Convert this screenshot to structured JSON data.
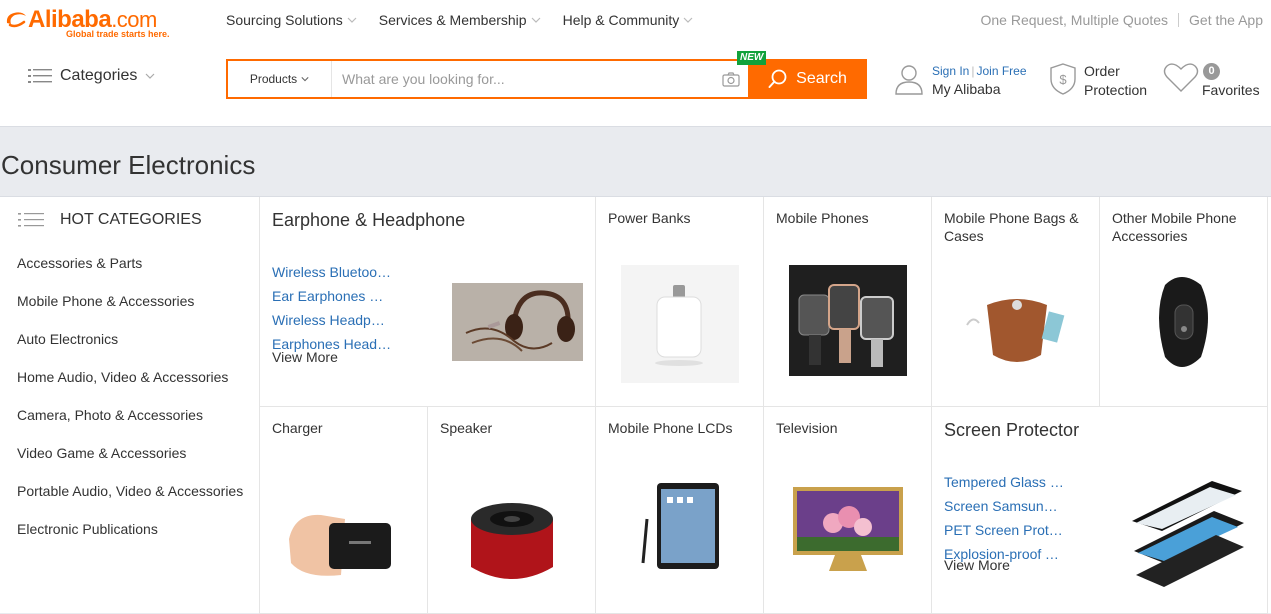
{
  "brand": {
    "logo_name": "Alibaba",
    "logo_suffix": ".com",
    "tagline": "Global trade starts here.",
    "color": "#ff6a00"
  },
  "topnav": [
    {
      "label": "Sourcing Solutions"
    },
    {
      "label": "Services & Membership"
    },
    {
      "label": "Help & Community"
    }
  ],
  "toplinks": {
    "quotes": "One Request, Multiple Quotes",
    "app": "Get the App"
  },
  "header": {
    "categories_label": "Categories"
  },
  "search": {
    "type_label": "Products",
    "placeholder": "What are you looking for...",
    "button_label": "Search",
    "new_badge": "NEW"
  },
  "user": {
    "sign_in": "Sign In",
    "join": "Join Free",
    "my_alibaba": "My Alibaba"
  },
  "order_protection": {
    "line1": "Order",
    "line2": "Protection"
  },
  "favorites": {
    "count": "0",
    "label": "Favorites"
  },
  "page": {
    "title": "Consumer Electronics"
  },
  "sidebar": {
    "title": "HOT CATEGORIES",
    "items": [
      "Accessories & Parts",
      "Mobile Phone & Accessories",
      "Auto Electronics",
      "Home Audio, Video & Accessories",
      "Camera, Photo & Accessories",
      "Video Game & Accessories",
      "Portable Audio, Video & Accessories",
      "Electronic Publications"
    ]
  },
  "tiles": {
    "earphone": {
      "title": "Earphone & Headphone",
      "links": [
        "Wireless Bluetooth Earphones",
        "Ear Earphones Headphones",
        "Wireless Headphones",
        "Earphones Headphones"
      ],
      "view_more": "View More"
    },
    "power_banks": {
      "title": "Power Banks"
    },
    "mobile_phones": {
      "title": "Mobile Phones"
    },
    "phone_bags": {
      "title": "Mobile Phone Bags & Cases"
    },
    "other_accessories": {
      "title": "Other Mobile Phone Accessories"
    },
    "charger": {
      "title": "Charger"
    },
    "speaker": {
      "title": "Speaker"
    },
    "lcds": {
      "title": "Mobile Phone LCDs"
    },
    "television": {
      "title": "Television"
    },
    "screen_protector": {
      "title": "Screen Protector",
      "links": [
        "Tempered Glass Screen Protector",
        "Screen Samsung Protector",
        "PET Screen Protector",
        "Explosion-proof Tempered Glass"
      ],
      "view_more": "View More"
    }
  }
}
